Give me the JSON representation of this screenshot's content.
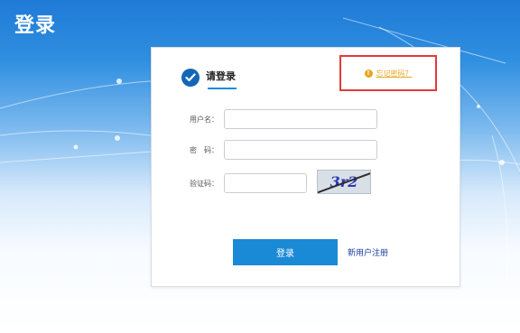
{
  "header": {
    "title": "登录"
  },
  "login": {
    "tab_label": "请登录",
    "forgot_password": "忘记密码？",
    "fields": {
      "username": {
        "label": "用户名：",
        "value": ""
      },
      "password": {
        "label": "密　码：",
        "value": ""
      },
      "captcha": {
        "label": "验证码：",
        "value": ""
      }
    },
    "captcha_image_text": "3r2",
    "login_button": "登录",
    "register_link": "新用户注册"
  },
  "colors": {
    "primary": "#1b8ad6",
    "check_icon": "#1566b6",
    "warning": "#e9a51e",
    "highlight_box": "#e53a3a",
    "link": "#1a3fa0"
  },
  "icons": {
    "tab": "check-circle-icon",
    "forgot": "warning-icon"
  }
}
